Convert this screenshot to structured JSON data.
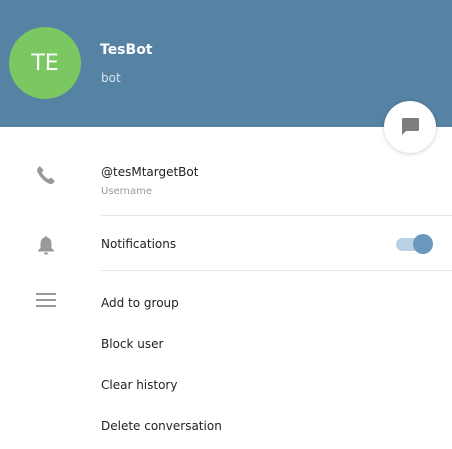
{
  "profile": {
    "avatar_initials": "TE",
    "name": "TesBot",
    "status": "bot"
  },
  "info": {
    "username_value": "@tesMtargetBot",
    "username_label": "Username",
    "notifications_label": "Notifications",
    "notifications_enabled": true
  },
  "actions": {
    "add_to_group": "Add to group",
    "block_user": "Block user",
    "clear_history": "Clear history",
    "delete_conversation": "Delete conversation"
  },
  "icons": {
    "message": "message-icon",
    "phone": "phone-icon",
    "bell": "bell-icon",
    "menu": "menu-icon"
  },
  "colors": {
    "header": "#5682a3",
    "avatar": "#7bc862",
    "toggle_knob": "#6a96bf",
    "toggle_track": "#b9d1e3",
    "icon": "#999999"
  }
}
